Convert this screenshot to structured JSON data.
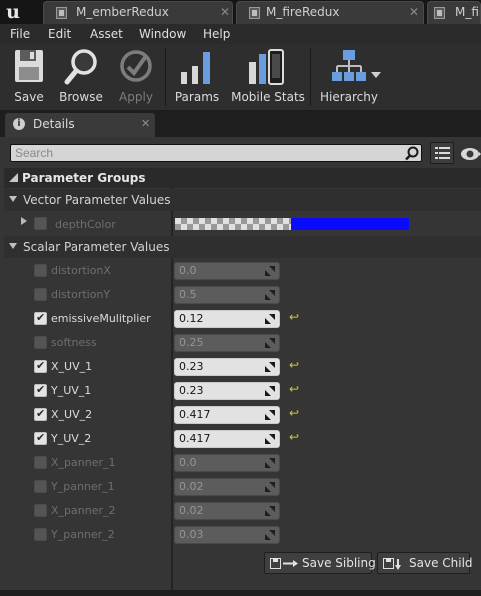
{
  "tabs": [
    {
      "label": "M_emberRedux",
      "close": "✕"
    },
    {
      "label": "M_fireRedux",
      "close": "✕"
    },
    {
      "label": "M_fir"
    }
  ],
  "logo_glyph": "u",
  "menu": [
    "File",
    "Edit",
    "Asset",
    "Window",
    "Help"
  ],
  "toolbar": {
    "save": "Save",
    "browse": "Browse",
    "apply": "Apply",
    "params": "Params",
    "mobile_stats": "Mobile Stats",
    "hierarchy": "Hierarchy"
  },
  "details_tab": {
    "label": "Details",
    "close": "✕",
    "info_glyph": "i"
  },
  "search": {
    "placeholder": "Search"
  },
  "parameter_groups": {
    "title": "Parameter Groups",
    "vector_title": "Vector Parameter Values",
    "scalar_title": "Scalar Parameter Values",
    "vector_params": [
      {
        "name": "depthColor",
        "color": "#0a0aff"
      }
    ],
    "scalar_params": [
      {
        "name": "distortionX",
        "value": "0.0",
        "enabled": false
      },
      {
        "name": "distortionY",
        "value": "0.5",
        "enabled": false
      },
      {
        "name": "emissiveMulitplier",
        "value": "0.12",
        "enabled": true
      },
      {
        "name": "softness",
        "value": "0.25",
        "enabled": false
      },
      {
        "name": "X_UV_1",
        "value": "0.23",
        "enabled": true
      },
      {
        "name": "Y_UV_1",
        "value": "0.23",
        "enabled": true
      },
      {
        "name": "X_UV_2",
        "value": "0.417",
        "enabled": true
      },
      {
        "name": "Y_UV_2",
        "value": "0.417",
        "enabled": true
      },
      {
        "name": "X_panner_1",
        "value": "0.0",
        "enabled": false
      },
      {
        "name": "Y_panner_1",
        "value": "0.02",
        "enabled": false
      },
      {
        "name": "X_panner_2",
        "value": "0.02",
        "enabled": false
      },
      {
        "name": "Y_panner_2",
        "value": "0.03",
        "enabled": false
      }
    ]
  },
  "buttons": {
    "save_sibling": "Save Sibling",
    "save_child": "Save Child"
  },
  "reset_glyph": "↩",
  "colors": {
    "accent_reset": "#d3c63a",
    "vector_blue": "#0a0aff"
  }
}
